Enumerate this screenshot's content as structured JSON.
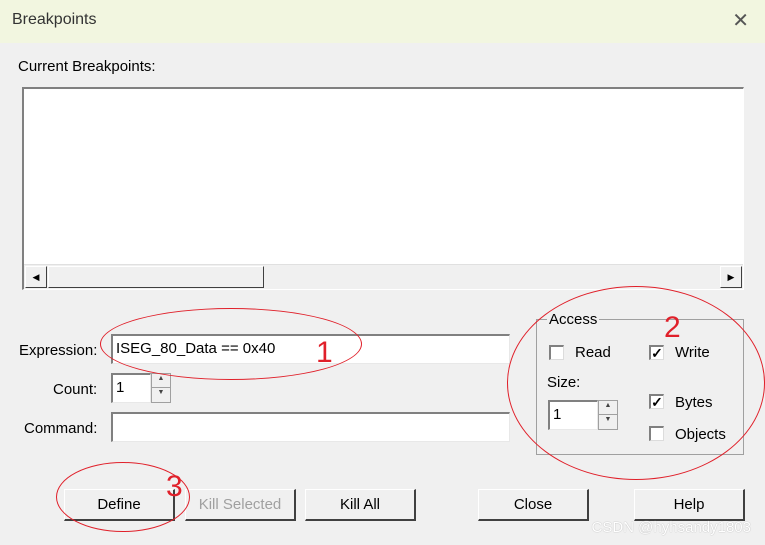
{
  "window": {
    "title": "Breakpoints",
    "close_glyph": "✕"
  },
  "labels": {
    "current_breakpoints": "Current Breakpoints:",
    "expression": "Expression:",
    "count": "Count:",
    "command": "Command:",
    "access": "Access",
    "size": "Size:"
  },
  "fields": {
    "expression_value": "ISEG_80_Data == 0x40",
    "count_value": "1",
    "command_value": "",
    "size_value": "1"
  },
  "checkboxes": {
    "read": {
      "label": "Read",
      "checked": false
    },
    "write": {
      "label": "Write",
      "checked": true
    },
    "bytes": {
      "label": "Bytes",
      "checked": true
    },
    "objects": {
      "label": "Objects",
      "checked": false
    }
  },
  "buttons": {
    "define": "Define",
    "kill_selected": "Kill Selected",
    "kill_all": "Kill All",
    "close": "Close",
    "help": "Help"
  },
  "annotations": {
    "n1": "1",
    "n2": "2",
    "n3": "3"
  },
  "watermark": "CSDN @hyhsandy1803",
  "colors": {
    "annotation_red": "#e0202a",
    "titlebar_bg": "#f2f6e0",
    "dialog_bg": "#f0f0f0"
  }
}
